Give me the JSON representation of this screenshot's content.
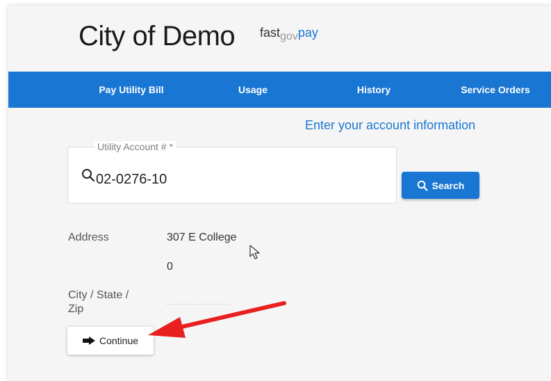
{
  "header": {
    "title": "City of Demo",
    "brand": {
      "part1": "fast",
      "part2": "gov",
      "part3": "pay"
    }
  },
  "nav": {
    "items": [
      {
        "label": "Pay Utility Bill"
      },
      {
        "label": "Usage"
      },
      {
        "label": "History"
      },
      {
        "label": "Service Orders"
      }
    ]
  },
  "form": {
    "heading": "Enter your account information",
    "account_label": "Utility Account # *",
    "account_value": "02-0276-10",
    "search_label": "Search",
    "search_icon": "search-icon"
  },
  "account_info": {
    "address_label": "Address",
    "address_line1": "307 E College",
    "address_line2": "0",
    "city_label": "City / State / Zip"
  },
  "actions": {
    "continue_label": "Continue",
    "continue_icon": "arrow-right-icon"
  },
  "colors": {
    "primary": "#1976d2",
    "annotation_arrow": "#e8201f"
  }
}
